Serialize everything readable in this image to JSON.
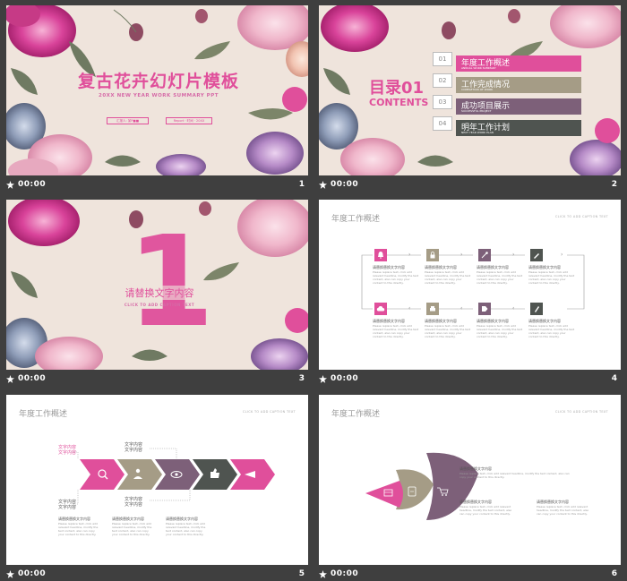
{
  "colors": {
    "pink": "#e04f9b",
    "taupe": "#a59c86",
    "plum": "#7d6079",
    "slate": "#4f5450",
    "cream": "#efe4dc"
  },
  "slides": [
    {
      "time": "00:00",
      "number": "1",
      "title": "复古花卉幻灯片模板",
      "subtitle": "20XX NEW YEAR WORK SUMMARY PPT",
      "left_box": "汇报人: 某P■■",
      "right_box": "Report · 时间 · 20XX"
    },
    {
      "time": "00:00",
      "number": "2",
      "heading": "目录01",
      "heading_en": "CONTENTS",
      "items": [
        {
          "num": "01",
          "label": "年度工作概述",
          "sub": "ANNUAL WORK SUMMARY"
        },
        {
          "num": "02",
          "label": "工作完成情况",
          "sub": "COMPLETION OF WORK"
        },
        {
          "num": "03",
          "label": "成功项目展示",
          "sub": "SUCCESSFUL PROJECT"
        },
        {
          "num": "04",
          "label": "明年工作计划",
          "sub": "NEXT YEAR WORK PLAN"
        }
      ]
    },
    {
      "time": "00:00",
      "number": "3",
      "big_number": "1",
      "title": "请替换文字内容",
      "caption": "CLICK TO ADD CAPTION TEXT"
    },
    {
      "time": "00:00",
      "number": "4",
      "title": "年度工作概述",
      "caption": "CLICK TO ADD CAPTION TEXT",
      "step_title": "请替换替换文字内容",
      "step_text": "Please replace text, click add relevant headline, modify the text content, also can copy your content to this directly."
    },
    {
      "time": "00:00",
      "number": "5",
      "title": "年度工作概述",
      "caption": "CLICK TO ADD CAPTION TEXT",
      "label": "文字内容",
      "col_title": "请替换替换文字内容",
      "col_text": "Please replace text, click add relevant headline, modify the text content, also can copy your content to this directly."
    },
    {
      "time": "00:00",
      "number": "6",
      "title": "年度工作概述",
      "caption": "CLICK TO ADD CAPTION TEXT",
      "text_title": "请替换替换文字内容",
      "text_body": "Please replace text, click add relevant headline, modify the text content, also can copy your content to this directly."
    }
  ]
}
